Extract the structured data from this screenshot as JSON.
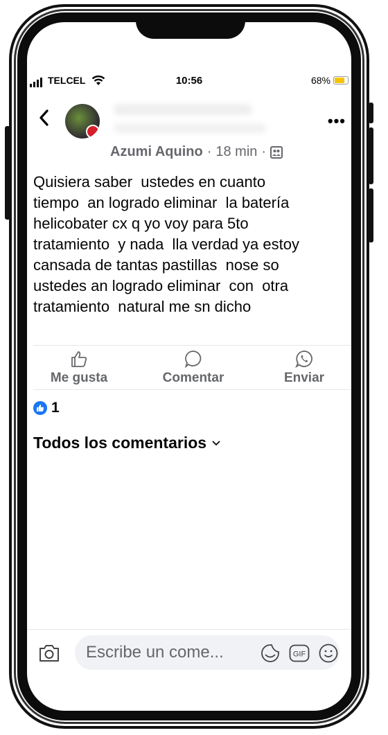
{
  "status_bar": {
    "carrier": "TELCEL",
    "time": "10:56",
    "battery_percent": "68%",
    "battery_level": 0.68
  },
  "post": {
    "author": "Azumi Aquino",
    "time_ago": "18 min",
    "separator": "·",
    "text": "Quisiera saber  ustedes en cuanto\ntiempo  an logrado eliminar  la batería\nhelicobater cx q yo voy para 5to\ntratamiento  y nada  lla verdad ya estoy\ncansada de tantas pastillas  nose so\nustedes an logrado eliminar  con  otra\ntratamiento  natural me sn dicho"
  },
  "actions": {
    "like": "Me gusta",
    "comment": "Comentar",
    "share": "Enviar"
  },
  "reactions": {
    "count": "1"
  },
  "comments": {
    "header": "Todos los comentarios"
  },
  "comment_bar": {
    "placeholder": "Escribe un come..."
  },
  "colors": {
    "facebook_blue": "#1877f2",
    "secondary_text": "#65676b",
    "battery_yellow": "#f5c400"
  },
  "icons": [
    "back-chevron-icon",
    "more-dots-icon",
    "group-icon",
    "like-thumb-icon",
    "comment-bubble-icon",
    "whatsapp-icon",
    "camera-icon",
    "sticker-icon",
    "gif-icon",
    "emoji-icon"
  ]
}
